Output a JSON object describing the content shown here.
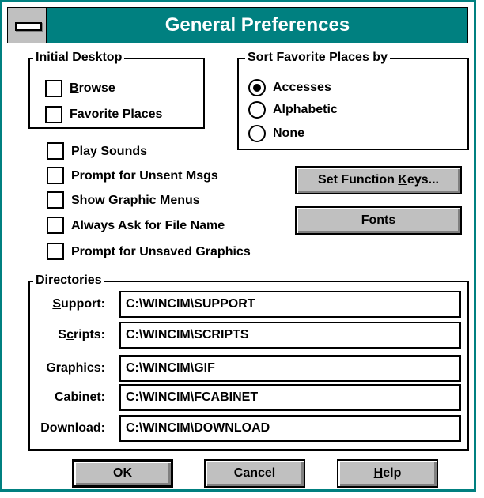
{
  "window": {
    "title": "General Preferences"
  },
  "initial_desktop": {
    "legend": "Initial Desktop",
    "browse": {
      "pre": "",
      "key": "B",
      "post": "rowse",
      "checked": false
    },
    "favorite_places": {
      "pre": "",
      "key": "F",
      "post": "avorite Places",
      "checked": false
    }
  },
  "sort_favorites": {
    "legend": "Sort Favorite Places by",
    "options": [
      {
        "label": "Accesses",
        "selected": true
      },
      {
        "label": "Alphabetic",
        "selected": false
      },
      {
        "label": "None",
        "selected": false
      }
    ]
  },
  "options": {
    "play_sounds": {
      "label": "Play Sounds",
      "checked": false
    },
    "prompt_unsent": {
      "label": "Prompt for Unsent Msgs",
      "checked": false
    },
    "show_graphic_menus": {
      "label": "Show Graphic Menus",
      "checked": false
    },
    "always_ask_filename": {
      "label": "Always Ask for File Name",
      "checked": false
    },
    "prompt_unsaved_graphics": {
      "label": "Prompt for Unsaved Graphics",
      "checked": false
    }
  },
  "buttons": {
    "function_keys": {
      "pre": "Set Function ",
      "key": "K",
      "post": "eys..."
    },
    "fonts": "Fonts",
    "ok": "OK",
    "cancel": "Cancel",
    "help": {
      "pre": "",
      "key": "H",
      "post": "elp"
    }
  },
  "directories": {
    "legend": "Directories",
    "support": {
      "pre": "",
      "key": "S",
      "post": "upport:",
      "value": "C:\\WINCIM\\SUPPORT"
    },
    "scripts": {
      "pre": "S",
      "key": "c",
      "post": "ripts:",
      "value": "C:\\WINCIM\\SCRIPTS"
    },
    "graphics": {
      "pre": "Graphics:",
      "key": "",
      "post": "",
      "value": "C:\\WINCIM\\GIF"
    },
    "cabinet": {
      "pre": "Cabi",
      "key": "n",
      "post": "et:",
      "value": "C:\\WINCIM\\FCABINET"
    },
    "download": {
      "pre": "Download:",
      "key": "",
      "post": "",
      "value": "C:\\WINCIM\\DOWNLOAD"
    }
  }
}
